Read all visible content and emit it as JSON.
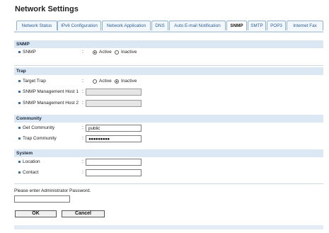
{
  "header": {
    "title": "Network Settings"
  },
  "tabs": [
    {
      "label": "Network Status"
    },
    {
      "label": "IPv6 Configuration"
    },
    {
      "label": "Network Application"
    },
    {
      "label": "DNS"
    },
    {
      "label": "Auto E-mail Notification"
    },
    {
      "label": "SNMP",
      "active": true
    },
    {
      "label": "SMTP"
    },
    {
      "label": "POP3"
    },
    {
      "label": "Internet Fax"
    }
  ],
  "snmp": {
    "header": "SNMP",
    "label": "SNMP",
    "colon": ":",
    "options": [
      "Active",
      "Inactive"
    ],
    "selected": "Active"
  },
  "trap": {
    "header": "Trap",
    "target_trap": {
      "label": "Target Trap",
      "colon": ":",
      "options": [
        "Active",
        "Inactive"
      ],
      "selected": "Inactive"
    },
    "host1": {
      "label": "SNMP Management Host 1",
      "colon": ":",
      "value": ""
    },
    "host2": {
      "label": "SNMP Management Host 2",
      "colon": ":",
      "value": ""
    }
  },
  "community": {
    "header": "Community",
    "get": {
      "label": "Get Community",
      "colon": ":",
      "value": "public"
    },
    "trap": {
      "label": "Trap Community",
      "colon": ":",
      "value": "●●●●●●●●●"
    }
  },
  "system": {
    "header": "System",
    "location": {
      "label": "Location",
      "colon": ":",
      "value": ""
    },
    "contact": {
      "label": "Contact",
      "colon": ":",
      "value": ""
    }
  },
  "admin": {
    "prompt": "Please enter Administrator Password.",
    "password_value": ""
  },
  "buttons": {
    "ok": "OK",
    "cancel": "Cancel"
  },
  "colors": {
    "accent": "#3a6ea5",
    "section_bg": "#dbe7f3",
    "tab_text": "#2d5e93"
  }
}
